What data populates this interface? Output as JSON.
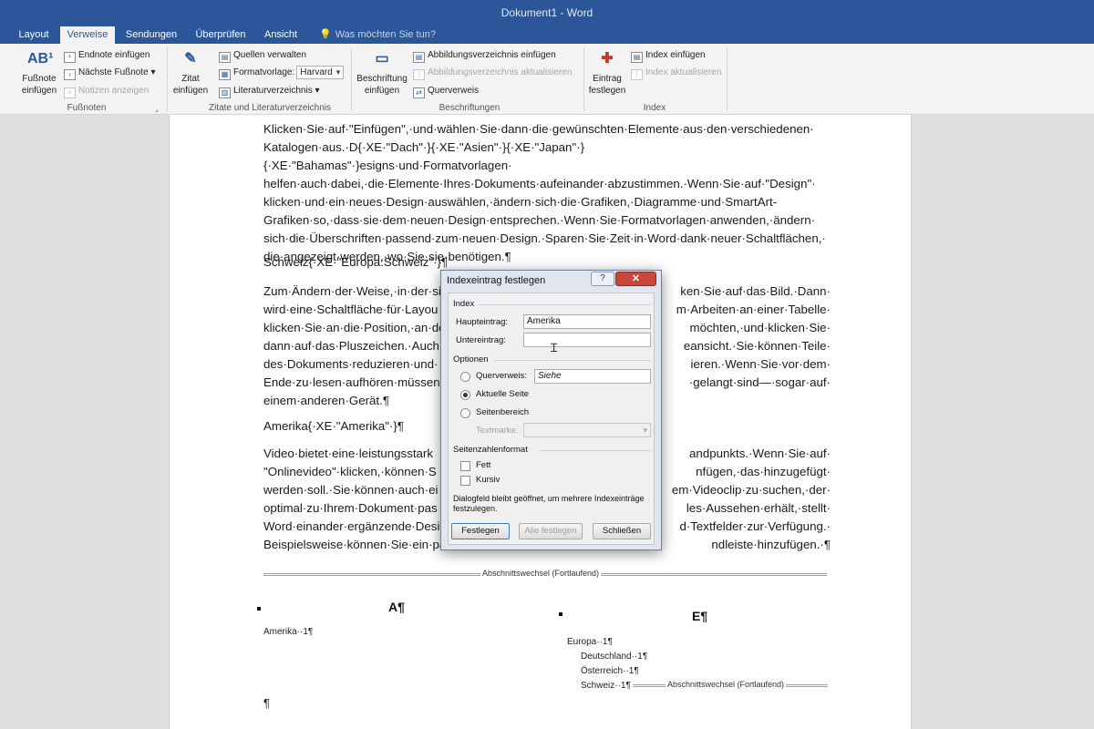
{
  "app": {
    "title": "Dokument1 - Word",
    "tabs": [
      "Layout",
      "Verweise",
      "Sendungen",
      "Überprüfen",
      "Ansicht"
    ],
    "active_tab": "Verweise",
    "tell_me": "Was möchten Sie tun?"
  },
  "ribbon": {
    "footnotes": {
      "label": "Fußnoten",
      "insert_footnote": "Fußnote einfügen",
      "insert_endnote": "Endnote einfügen",
      "next_footnote": "Nächste Fußnote",
      "show_notes": "Notizen anzeigen"
    },
    "citations": {
      "label": "Zitate und Literaturverzeichnis",
      "insert_citation": "Zitat einfügen",
      "manage_sources": "Quellen verwalten",
      "style_label": "Formatvorlage:",
      "style_value": "Harvard",
      "bibliography": "Literaturverzeichnis"
    },
    "captions": {
      "label": "Beschriftungen",
      "insert_caption": "Beschriftung einfügen",
      "insert_table_of_figures": "Abbildungsverzeichnis einfügen",
      "update_table": "Abbildungsverzeichnis aktualisieren",
      "cross_reference": "Querverweis"
    },
    "index": {
      "label": "Index",
      "mark_entry": "Eintrag festlegen",
      "insert_index": "Index einfügen",
      "update_index": "Index aktualisieren"
    }
  },
  "document": {
    "para1": [
      "Klicken·Sie·auf·\"Einfügen\",·und·wählen·Sie·dann·die·gewünschten·Elemente·aus·den·verschiedenen·",
      "Katalogen·aus.·D{·XE·\"Dach\"·}{·XE·\"Asien\"·}{·XE·\"Japan\"·}{·XE·\"Bahamas\"·}esigns·und·Formatvorlagen·",
      "helfen·auch·dabei,·die·Elemente·Ihres·Dokuments·aufeinander·abzustimmen.·Wenn·Sie·auf·\"Design\"·",
      "klicken·und·ein·neues·Design·auswählen,·ändern·sich·die·Grafiken,·Diagramme·und·SmartArt-",
      "Grafiken·so,·dass·sie·dem·neuen·Design·entsprechen.·Wenn·Sie·Formatvorlagen·anwenden,·ändern·",
      "sich·die·Überschriften·passend·zum·neuen·Design.·Sparen·Sie·Zeit·in·Word·dank·neuer·Schaltflächen,·",
      "die·angezeigt·werden,·wo·Sie·sie·benötigen.¶"
    ],
    "schweiz_line": "Schweiz{·XE·\"Europa:Schweiz\"·}¶",
    "para2": [
      "Zum·Ändern·der·Weise,·in·der·si",
      "wird·eine·Schaltfläche·für·Layou",
      "klicken·Sie·an·die·Position,·an·de",
      "dann·auf·das·Pluszeichen.·Auch·",
      "des·Dokuments·reduzieren·und·",
      "Ende·zu·lesen·aufhören·müssen,",
      "einem·anderen·Gerät.¶"
    ],
    "para2_right": [
      "ken·Sie·auf·das·Bild.·Dann·",
      "m·Arbeiten·an·einer·Tabelle·",
      "möchten,·und·klicken·Sie·",
      "eansicht.·Sie·können·Teile·",
      "ieren.·Wenn·Sie·vor·dem·",
      "·gelangt·sind—·sogar·auf·"
    ],
    "amerika_line": "Amerika{·XE·\"Amerika\"·}¶",
    "para3": [
      "Video·bietet·eine·leistungsstark",
      "\"Onlinevideo\"·klicken,·können·S",
      "werden·soll.·Sie·können·auch·ei",
      "optimal·zu·Ihrem·Dokument·pas",
      "Word·einander·ergänzende·Desi",
      "Beispielsweise·können·Sie·ein·pa"
    ],
    "para3_right": [
      "andpunkts.·Wenn·Sie·auf·",
      "nfügen,·das·hinzugefügt·",
      "em·Videoclip·zu·suchen,·der·",
      "les·Aussehen·erhält,·stellt·",
      "d·Textfelder·zur·Verfügung.·",
      "ndleiste·hinzufügen.·¶"
    ],
    "section_break": "Abschnittswechsel (Fortlaufend)",
    "index_left": {
      "heading": "A¶",
      "entry": "Amerika··1¶",
      "trailing": "¶"
    },
    "index_right": {
      "heading": "E¶",
      "entry": "Europa··1¶",
      "subentries": [
        "Deutschland··1¶",
        "Österreich··1¶",
        "Schweiz··1¶"
      ],
      "section_break": "Abschnittswechsel (Fortlaufend)"
    }
  },
  "dialog": {
    "title": "Indexeintrag festlegen",
    "help": "?",
    "close": "✕",
    "index_section": "Index",
    "main_entry_label": "Haupteintrag:",
    "main_entry_value": "Amerika",
    "sub_entry_label": "Untereintrag:",
    "sub_entry_value": "",
    "options_section": "Optionen",
    "opt_crossref": "Querverweis:",
    "opt_crossref_value": "Siehe",
    "opt_current_page": "Aktuelle Seite",
    "opt_page_range": "Seitenbereich",
    "bookmark_label": "Textmarke:",
    "format_section": "Seitenzahlenformat",
    "bold": "Fett",
    "italic": "Kursiv",
    "note": "Dialogfeld bleibt geöffnet, um mehrere Indexeinträge festzulegen.",
    "btn_mark": "Festlegen",
    "btn_mark_all": "Alle festlegen",
    "btn_close": "Schließen"
  }
}
